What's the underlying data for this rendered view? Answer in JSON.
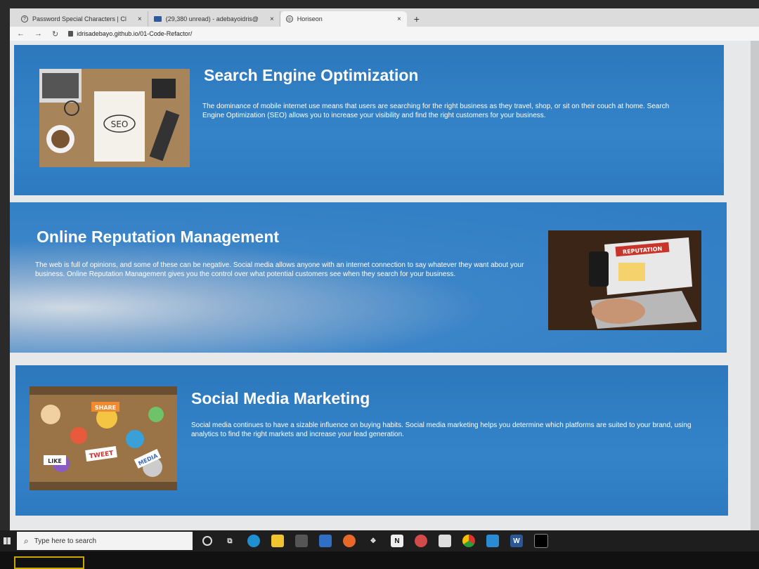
{
  "browser": {
    "tabs": [
      {
        "label": "Password Special Characters | Cl",
        "icon": "password-icon"
      },
      {
        "label": "(29,380 unread) - adebayoidris@",
        "icon": "mail-icon"
      },
      {
        "label": "Horiseon",
        "icon": "globe-icon",
        "active": true
      }
    ],
    "new_tab": "+",
    "close_symbol": "×",
    "url": "idrisadebayo.github.io/01-Code-Refactor/"
  },
  "sections": [
    {
      "title": "Search Engine Optimization",
      "text": "The dominance of mobile internet use means that users are searching for the right business as they travel, shop, or sit on their couch at home. Search Engine Optimization (SEO) allows you to increase your visibility and find the right customers for your business.",
      "image_label": "SEO"
    },
    {
      "title": "Online Reputation Management",
      "text": "The web is full of opinions, and some of these can be negative. Social media allows anyone with an internet connection to say whatever they want about your business. Online Reputation Management gives you the control over what potential customers see when they search for your business.",
      "image_label": "REPUTATION"
    },
    {
      "title": "Social Media Marketing",
      "text": "Social media continues to have a sizable influence on buying habits. Social media marketing helps you determine which platforms are suited to your brand, using analytics to find the right markets and increase your lead generation.",
      "image_labels": [
        "SHARE",
        "TWEET",
        "LIKE",
        "MEDIA"
      ]
    }
  ],
  "taskbar": {
    "search_placeholder": "Type here to search",
    "apps": [
      "cortana-icon",
      "task-view-icon",
      "edge-icon",
      "file-explorer-icon",
      "store-icon",
      "mail-icon",
      "firefox-icon",
      "dropbox-icon",
      "notion-icon",
      "app-icon",
      "notes-icon",
      "chrome-icon",
      "vscode-icon",
      "word-icon",
      "terminal-icon"
    ],
    "notion_letter": "N",
    "word_letter": "W"
  },
  "colors": {
    "section_blue": "#2f7dc4",
    "page_bg": "#e6e8ea"
  }
}
